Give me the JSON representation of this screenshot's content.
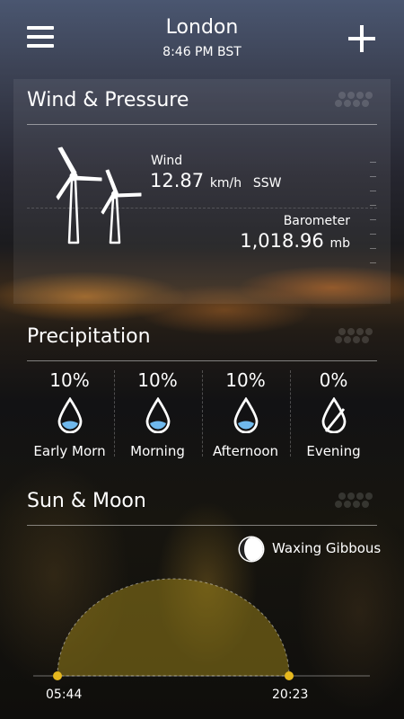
{
  "header": {
    "city": "London",
    "time": "8:46 PM BST",
    "menu_icon": "hamburger-menu-icon",
    "add_icon": "plus-icon"
  },
  "wind_pressure": {
    "title": "Wind & Pressure",
    "wind_label": "Wind",
    "wind_speed": "12.87",
    "wind_unit": "km/h",
    "wind_direction": "SSW",
    "barometer_label": "Barometer",
    "barometer_value": "1,018.96",
    "barometer_unit": "mb",
    "icon": "wind-turbine-icon"
  },
  "precipitation": {
    "title": "Precipitation",
    "periods": [
      {
        "percent": "10%",
        "label": "Early Morn",
        "icon": "raindrop-icon"
      },
      {
        "percent": "10%",
        "label": "Morning",
        "icon": "raindrop-icon"
      },
      {
        "percent": "10%",
        "label": "Afternoon",
        "icon": "raindrop-icon"
      },
      {
        "percent": "0%",
        "label": "Evening",
        "icon": "no-rain-drop-icon"
      }
    ]
  },
  "sun_moon": {
    "title": "Sun & Moon",
    "moon_phase": "Waxing Gibbous",
    "moon_icon": "moon-phase-icon",
    "sunrise": "05:44",
    "sunset": "20:23",
    "sun_arc_color": "#e6b81e"
  }
}
